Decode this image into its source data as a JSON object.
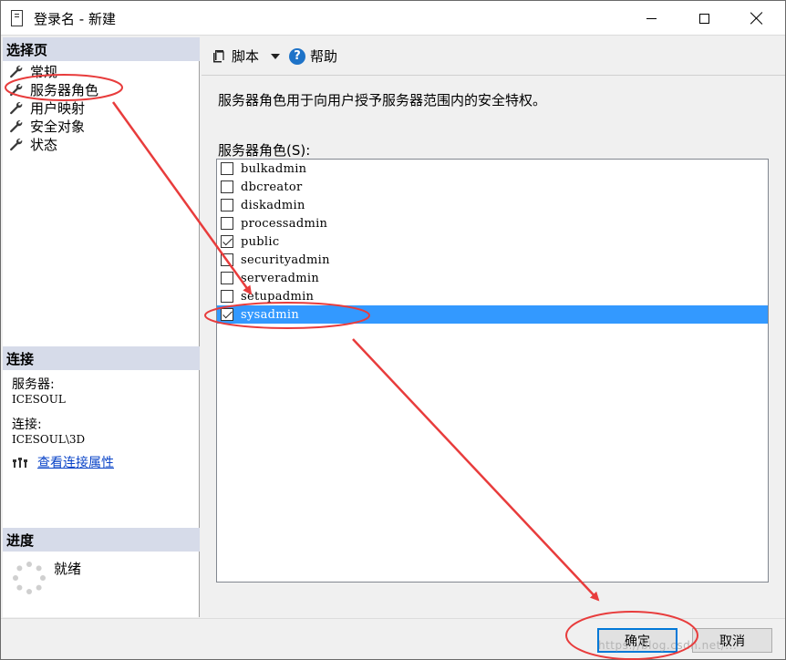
{
  "window": {
    "title": "登录名 - 新建",
    "controls": {
      "minimize_icon": "minimize-icon",
      "maximize_icon": "maximize-icon",
      "close_icon": "close-icon"
    }
  },
  "sidebar": {
    "select_page_header": "选择页",
    "pages": [
      {
        "label": "常规",
        "icon": "wrench-icon"
      },
      {
        "label": "服务器角色",
        "icon": "wrench-icon"
      },
      {
        "label": "用户映射",
        "icon": "wrench-icon"
      },
      {
        "label": "安全对象",
        "icon": "wrench-icon"
      },
      {
        "label": "状态",
        "icon": "wrench-icon"
      }
    ],
    "connection_header": "连接",
    "server_label": "服务器:",
    "server_value": "ICESOUL",
    "connection_label": "连接:",
    "connection_value": "ICESOUL\\3D",
    "view_connection_properties": "查看连接属性",
    "progress_header": "进度",
    "progress_status": "就绪"
  },
  "toolbar": {
    "script_label": "脚本",
    "help_label": "帮助"
  },
  "main": {
    "description": "服务器角色用于向用户授予服务器范围内的安全特权。",
    "roles_label": "服务器角色(S):",
    "roles": [
      {
        "name": "bulkadmin",
        "checked": false
      },
      {
        "name": "dbcreator",
        "checked": false
      },
      {
        "name": "diskadmin",
        "checked": false
      },
      {
        "name": "processadmin",
        "checked": false
      },
      {
        "name": "public",
        "checked": true
      },
      {
        "name": "securityadmin",
        "checked": false
      },
      {
        "name": "serveradmin",
        "checked": false
      },
      {
        "name": "setupadmin",
        "checked": false
      },
      {
        "name": "sysadmin",
        "checked": true,
        "selected": true
      }
    ]
  },
  "buttons": {
    "ok": "确定",
    "cancel": "取消"
  },
  "watermark": "https://blog.csdn.net/...",
  "colors": {
    "selection": "#3399ff",
    "section_header": "#d6dbe9",
    "link": "#0a44c8",
    "annotation": "#e83c3c"
  }
}
